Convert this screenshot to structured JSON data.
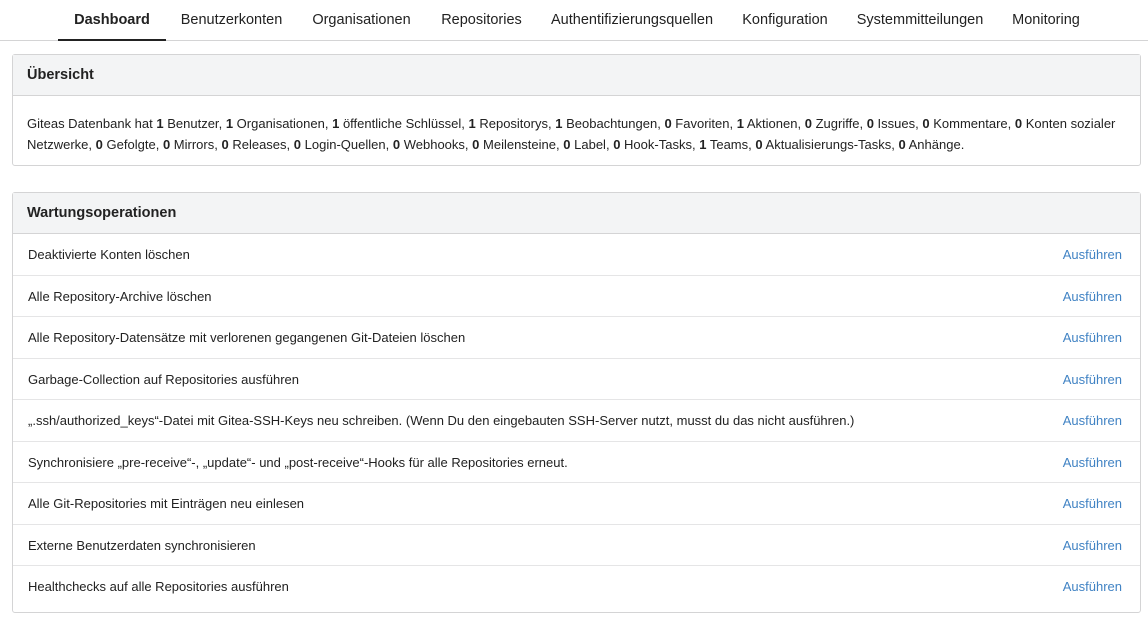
{
  "nav": {
    "tabs": [
      {
        "label": "Dashboard",
        "active": true
      },
      {
        "label": "Benutzerkonten",
        "active": false
      },
      {
        "label": "Organisationen",
        "active": false
      },
      {
        "label": "Repositories",
        "active": false
      },
      {
        "label": "Authentifizierungsquellen",
        "active": false
      },
      {
        "label": "Konfiguration",
        "active": false
      },
      {
        "label": "Systemmitteilungen",
        "active": false
      },
      {
        "label": "Monitoring",
        "active": false
      }
    ]
  },
  "overview": {
    "title": "Übersicht",
    "prefix": "Giteas Datenbank hat",
    "stats": [
      {
        "count": "1",
        "label": "Benutzer"
      },
      {
        "count": "1",
        "label": "Organisationen"
      },
      {
        "count": "1",
        "label": "öffentliche Schlüssel"
      },
      {
        "count": "1",
        "label": "Repositorys"
      },
      {
        "count": "1",
        "label": "Beobachtungen"
      },
      {
        "count": "0",
        "label": "Favoriten"
      },
      {
        "count": "1",
        "label": "Aktionen"
      },
      {
        "count": "0",
        "label": "Zugriffe"
      },
      {
        "count": "0",
        "label": "Issues"
      },
      {
        "count": "0",
        "label": "Kommentare"
      },
      {
        "count": "0",
        "label": "Konten sozialer Netzwerke"
      },
      {
        "count": "0",
        "label": "Gefolgte"
      },
      {
        "count": "0",
        "label": "Mirrors"
      },
      {
        "count": "0",
        "label": "Releases"
      },
      {
        "count": "0",
        "label": "Login-Quellen"
      },
      {
        "count": "0",
        "label": "Webhooks"
      },
      {
        "count": "0",
        "label": "Meilensteine"
      },
      {
        "count": "0",
        "label": "Label"
      },
      {
        "count": "0",
        "label": "Hook-Tasks"
      },
      {
        "count": "1",
        "label": "Teams"
      },
      {
        "count": "0",
        "label": "Aktualisierungs-Tasks"
      },
      {
        "count": "0",
        "label": "Anhänge"
      }
    ]
  },
  "maintenance": {
    "title": "Wartungsoperationen",
    "run_label": "Ausführen",
    "operations": [
      "Deaktivierte Konten löschen",
      "Alle Repository-Archive löschen",
      "Alle Repository-Datensätze mit verlorenen gegangenen Git-Dateien löschen",
      "Garbage-Collection auf Repositories ausführen",
      "„.ssh/authorized_keys“-Datei mit Gitea-SSH-Keys neu schreiben. (Wenn Du den eingebauten SSH-Server nutzt, musst du das nicht ausführen.)",
      "Synchronisiere „pre-receive“-, „update“- und „post-receive“-Hooks für alle Repositories erneut.",
      "Alle Git-Repositories mit Einträgen neu einlesen",
      "Externe Benutzerdaten synchronisieren",
      "Healthchecks auf alle Repositories ausführen"
    ]
  }
}
